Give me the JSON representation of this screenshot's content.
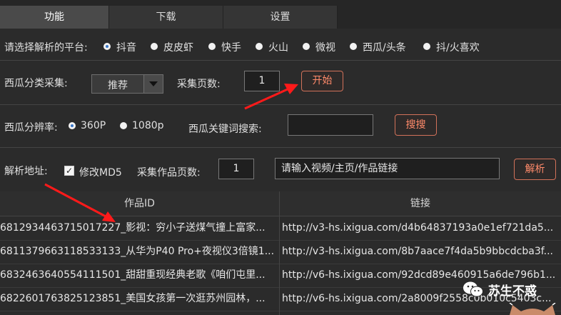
{
  "tabs": [
    "功能",
    "下载",
    "设置"
  ],
  "platform": {
    "label": "请选择解析的平台:",
    "options": [
      "抖音",
      "皮皮虾",
      "快手",
      "火山",
      "微视",
      "西瓜/头条",
      "抖/火喜欢"
    ],
    "selected": "抖音"
  },
  "xigua_collect": {
    "label": "西瓜分类采集:",
    "category_value": "推荐",
    "pages_label": "采集页数:",
    "pages_value": "1",
    "start_label": "开始"
  },
  "resolution": {
    "label": "西瓜分辨率:",
    "options": [
      "360P",
      "1080p"
    ],
    "selected": "360P",
    "keyword_label": "西瓜关键词搜索:",
    "keyword_value": "",
    "search_label": "搜搜"
  },
  "parse": {
    "label": "解析地址:",
    "md5_label": "修改MD5",
    "md5_checked": true,
    "works_pages_label": "采集作品页数:",
    "works_pages_value": "1",
    "url_value": "请输入视频/主页/作品链接",
    "parse_label": "解析"
  },
  "table": {
    "columns": [
      "作品ID",
      "链接"
    ],
    "rows": [
      [
        "6812934463715017227_影视：穷小子送煤气撞上富家...",
        "http://v3-hs.ixigua.com/d4b64837193a0e1ef721da5..."
      ],
      [
        "6811379663118533133_从华为P40 Pro+夜视仪3倍镜1...",
        "http://v3-hs.ixigua.com/8b7aace7f4da5b9bbcdcba3f..."
      ],
      [
        "6832463640554111501_甜甜重现经典老歌《咱们屯里...",
        "http://v6-hs.ixigua.com/92dcd89e460915a6de796b1..."
      ],
      [
        "6822601763825123851_美国女孩第一次逛苏州园林，...",
        "http://v6-hs.ixigua.com/2a8009f2558c0b010c5403c..."
      ]
    ]
  },
  "watermark": {
    "text": "苏生不惑"
  },
  "colors": {
    "accent": "#ff8a6a",
    "arrow": "#ff1a1a",
    "bg": "#2b2b2b"
  }
}
